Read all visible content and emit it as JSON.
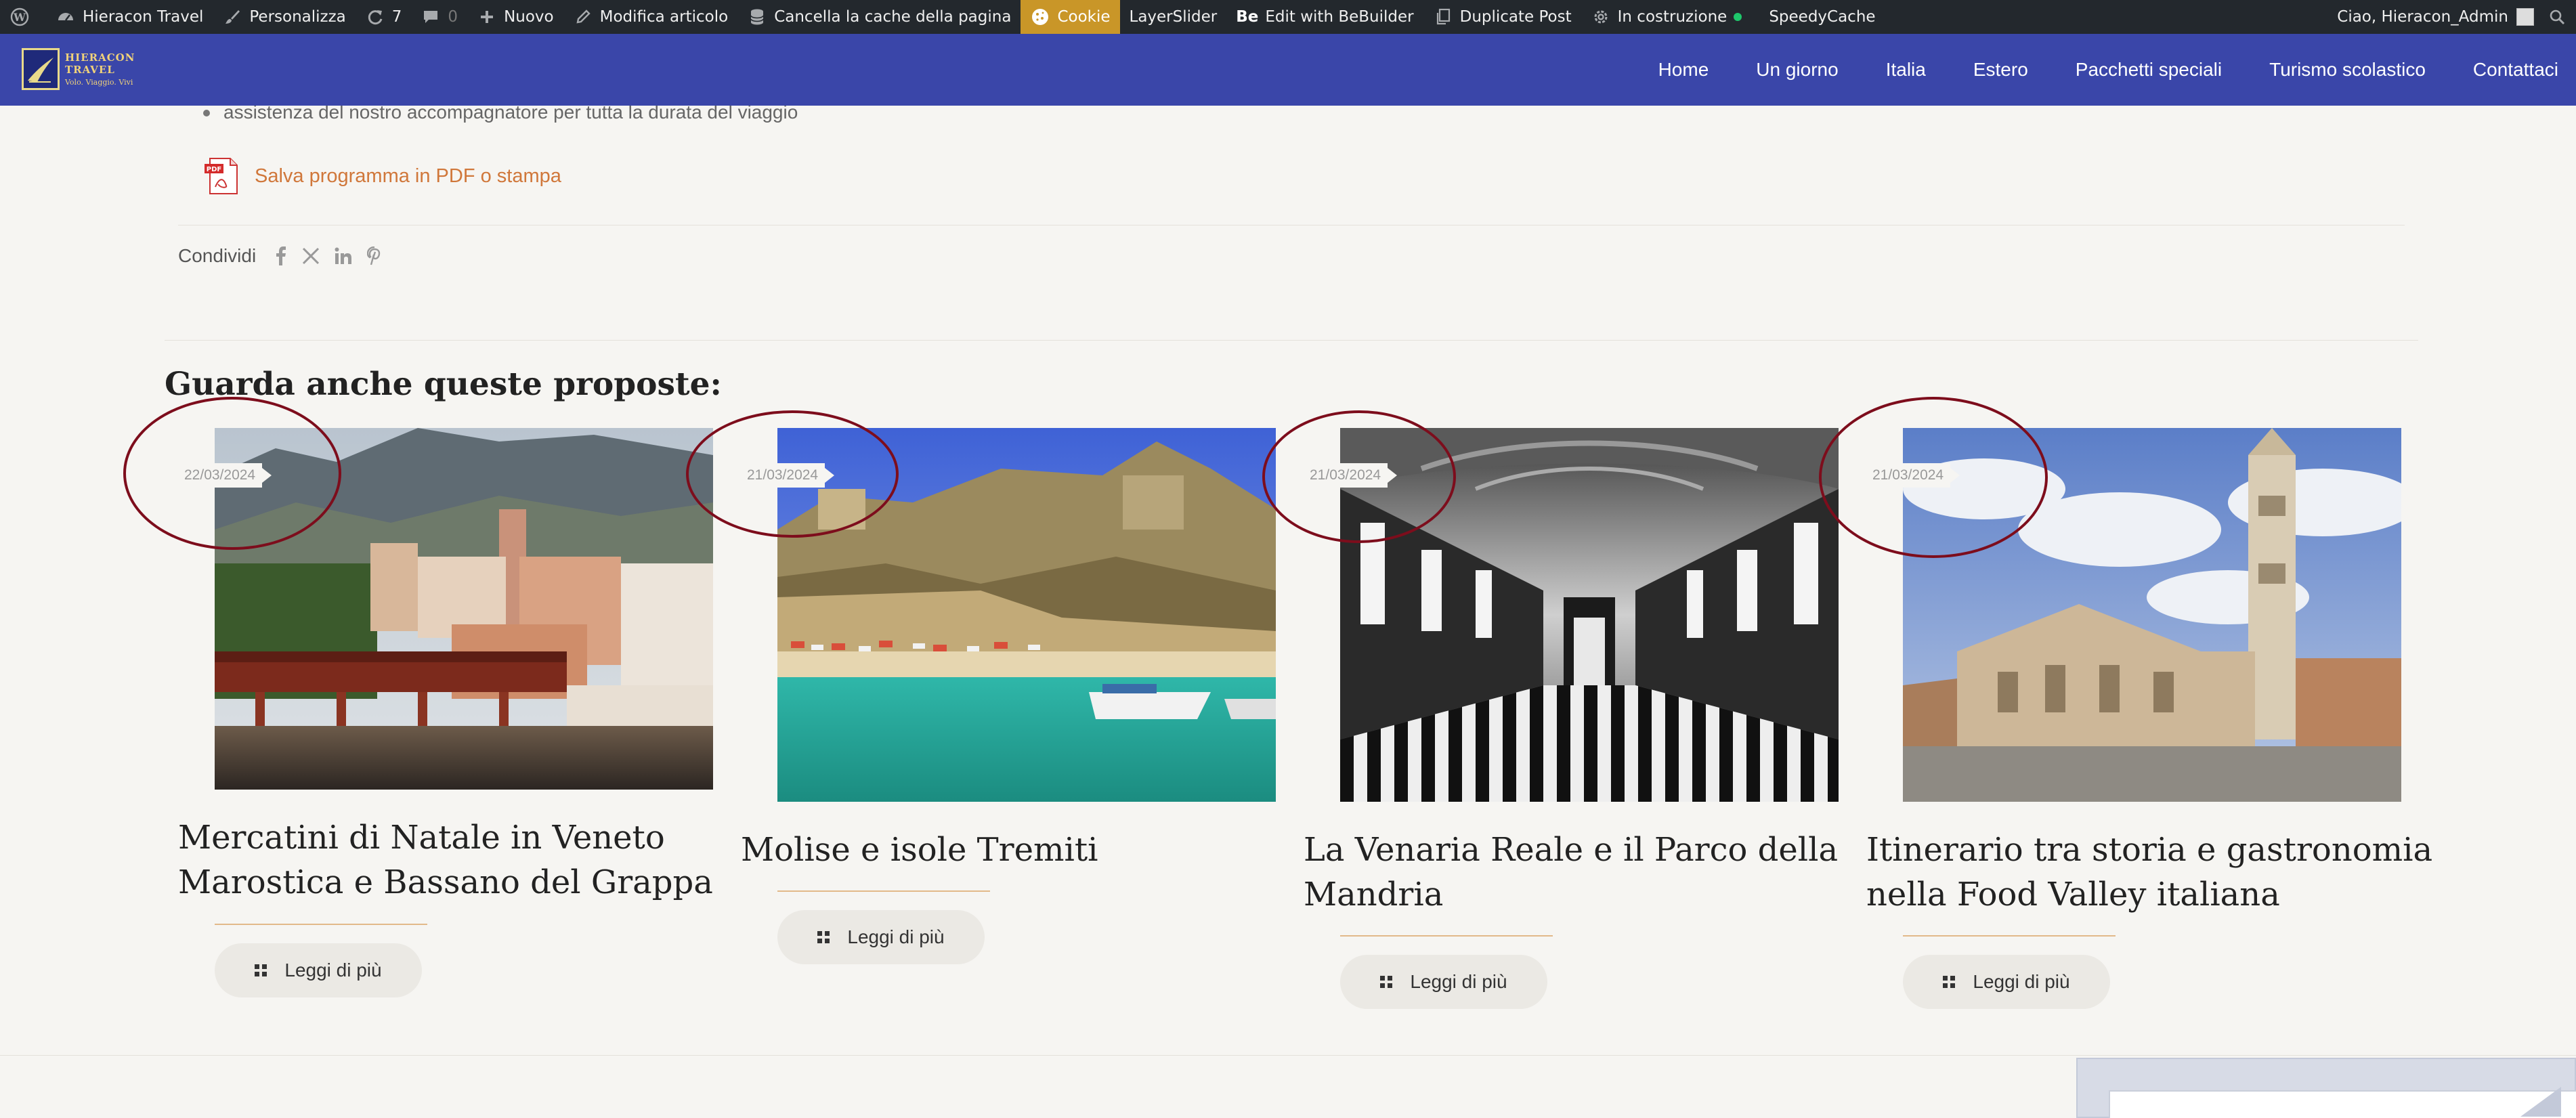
{
  "adminbar": {
    "site_name": "Hieracon Travel",
    "customize": "Personalizza",
    "updates_count": "7",
    "comments_count": "0",
    "new": "Nuovo",
    "edit_article": "Modifica articolo",
    "clear_cache": "Cancella la cache della pagina",
    "cookie": "Cookie",
    "layerslider": "LayerSlider",
    "bebuilder_prefix": "Be",
    "bebuilder": "Edit with BeBuilder",
    "duplicate_post": "Duplicate Post",
    "maintenance": "In costruzione",
    "speedycache": "SpeedyCache",
    "greeting": "Ciao, Hieracon_Admin",
    "icons": [
      "wordpress-icon",
      "dashboard-icon",
      "brush-icon",
      "refresh-icon",
      "comment-icon",
      "plus-icon",
      "pencil-icon",
      "database-icon",
      "cookie-icon",
      "copy-icon",
      "gear-icon",
      "search-icon"
    ]
  },
  "header": {
    "logo_line1": "HIERACON TRAVEL",
    "logo_line2": "Volo. Viaggio. Vivi",
    "nav": [
      "Home",
      "Un giorno",
      "Italia",
      "Estero",
      "Pacchetti speciali",
      "Turismo scolastico",
      "Contattaci"
    ],
    "bg_color": "#3a46a9"
  },
  "content": {
    "bullets": [
      "assistenza del nostro accompagnatore per tutta la durata del viaggio"
    ],
    "pdf_link": "Salva programma in PDF o stampa",
    "share_label": "Condividi",
    "share_icons": [
      "facebook-icon",
      "x-icon",
      "linkedin-icon",
      "pinterest-icon"
    ],
    "related_title": "Guarda anche queste proposte:"
  },
  "cards": [
    {
      "date": "22/03/2024",
      "title_line1": "Mercatini di Natale in Veneto",
      "title_line2": "Marostica e Bassano del Grappa",
      "button": "Leggi di più"
    },
    {
      "date": "21/03/2024",
      "title_line1": "Molise e isole Tremiti",
      "title_line2": "",
      "button": "Leggi di più"
    },
    {
      "date": "21/03/2024",
      "title_line1": "La Venaria Reale e il Parco della",
      "title_line2": "Mandria",
      "button": "Leggi di più"
    },
    {
      "date": "21/03/2024",
      "title_line1": "Itinerario tra storia e gastronomia",
      "title_line2": "nella Food Valley italiana",
      "button": "Leggi di più"
    }
  ],
  "colors": {
    "accent_link": "#d0773a",
    "annotation_ring": "#7d0d1c",
    "cookie_highlight": "#c99628"
  }
}
